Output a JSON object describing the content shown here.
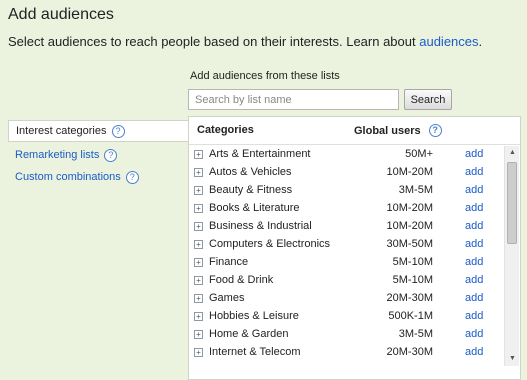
{
  "header": {
    "title": "Add audiences",
    "subtitle_text": "Select audiences to reach people based on their interests. Learn about",
    "subtitle_link": "audiences",
    "subtitle_period": "."
  },
  "search": {
    "label": "Add audiences from these lists",
    "placeholder": "Search by list name",
    "button_label": "Search"
  },
  "nav": {
    "items": [
      {
        "label": "Interest categories",
        "help": "?"
      },
      {
        "label": "Remarketing lists",
        "help": "?"
      },
      {
        "label": "Custom combinations",
        "help": "?"
      }
    ]
  },
  "table": {
    "col_categories": "Categories",
    "col_users": "Global users",
    "col_users_help": "?",
    "expand_glyph": "+",
    "add_label": "add",
    "rows": [
      {
        "name": "Arts & Entertainment",
        "users": "50M+"
      },
      {
        "name": "Autos & Vehicles",
        "users": "10M-20M"
      },
      {
        "name": "Beauty & Fitness",
        "users": "3M-5M"
      },
      {
        "name": "Books & Literature",
        "users": "10M-20M"
      },
      {
        "name": "Business & Industrial",
        "users": "10M-20M"
      },
      {
        "name": "Computers & Electronics",
        "users": "30M-50M"
      },
      {
        "name": "Finance",
        "users": "5M-10M"
      },
      {
        "name": "Food & Drink",
        "users": "5M-10M"
      },
      {
        "name": "Games",
        "users": "20M-30M"
      },
      {
        "name": "Hobbies & Leisure",
        "users": "500K-1M"
      },
      {
        "name": "Home & Garden",
        "users": "3M-5M"
      },
      {
        "name": "Internet & Telecom",
        "users": "20M-30M"
      }
    ]
  },
  "scrollbar": {
    "up_glyph": "▲",
    "down_glyph": "▼"
  }
}
